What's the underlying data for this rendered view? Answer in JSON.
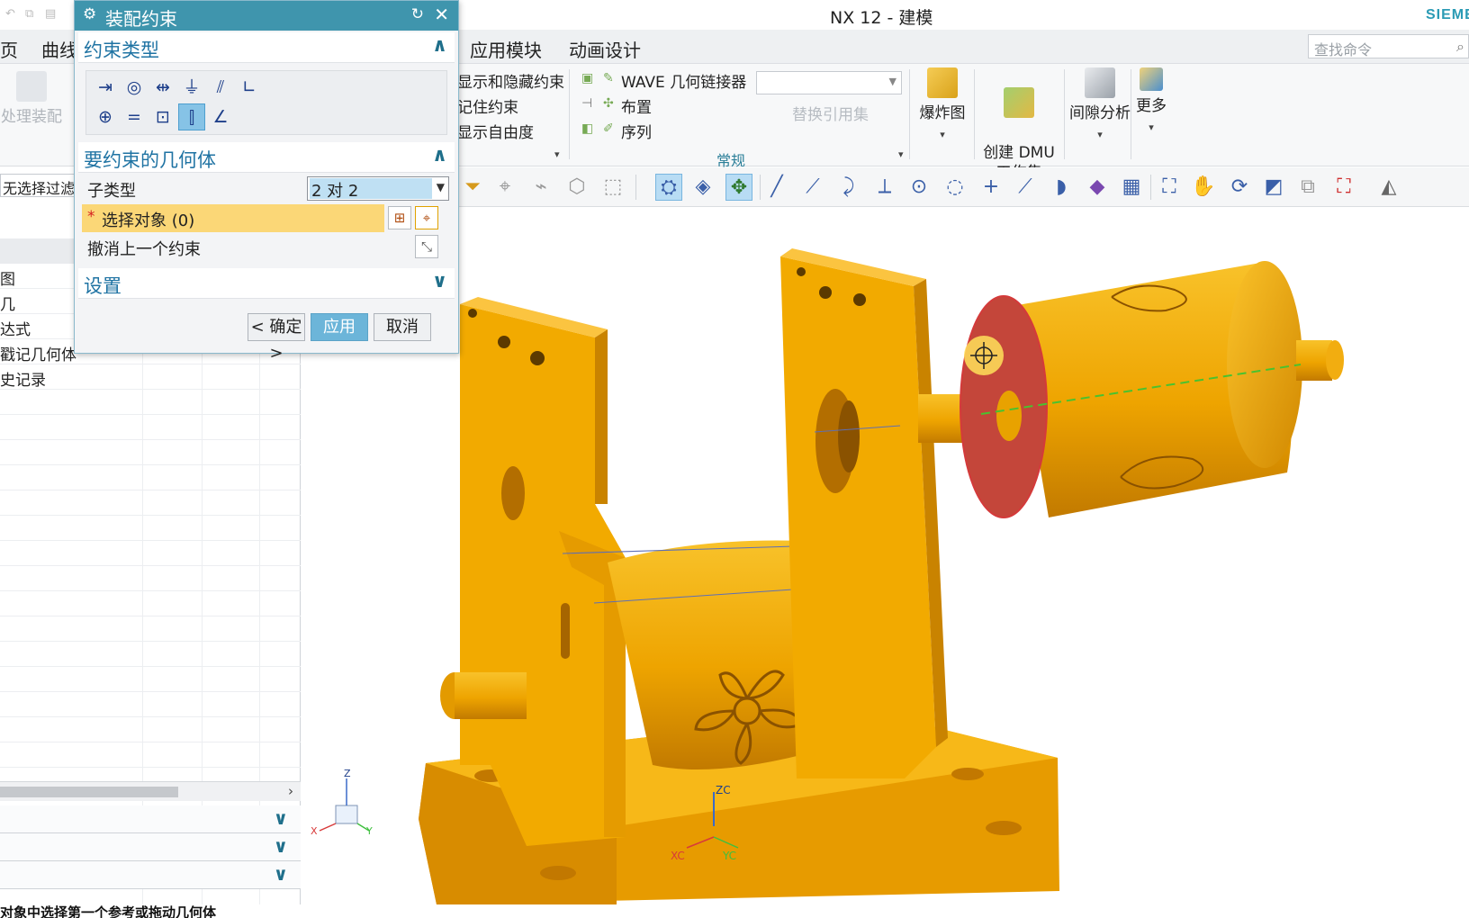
{
  "window": {
    "title": "NX 12 - 建模",
    "brand": "SIEMENS"
  },
  "menubar": {
    "items": [
      "页",
      "曲线",
      "应用模块",
      "动画设计"
    ],
    "search_placeholder": "查找命令"
  },
  "ribbon": {
    "left_button": "处理装配",
    "col1": [
      "显示和隐藏约束",
      "记住约束",
      "显示自由度"
    ],
    "col2": [
      "WAVE 几何链接器",
      "布置",
      "序列"
    ],
    "replace_ref": "替换引用集",
    "group_label": "常规",
    "big_buttons": [
      {
        "label": "爆炸图",
        "icon": "exploded-view-icon"
      },
      {
        "label": "创建 DMU\n工作集",
        "icon": "dmu-workset-icon"
      },
      {
        "label": "间隙分析",
        "icon": "clearance-analysis-icon"
      },
      {
        "label": "更多",
        "icon": "more-icon"
      }
    ]
  },
  "navigator": {
    "filter_value": "无选择过滤器",
    "rows": [
      "图",
      "几",
      "达式",
      "戳记几何体",
      "史记录"
    ]
  },
  "dialog": {
    "title": "装配约束",
    "sections": {
      "constraint_type": "约束类型",
      "geometry": "要约束的几何体",
      "settings": "设置"
    },
    "subtype_label": "子类型",
    "subtype_value": "2 对 2",
    "select_object": "选择对象 (0)",
    "undo_last": "撤消上一个约束",
    "buttons": {
      "ok": "< 确定 >",
      "apply": "应用",
      "cancel": "取消"
    }
  },
  "graphics": {
    "triad_labels": {
      "z": "Z",
      "x": "X",
      "y": "Y"
    },
    "wcs_labels": {
      "zc": "ZC",
      "xc": "XC",
      "yc": "YC"
    },
    "colors": {
      "part": "#f2a900",
      "part_shade": "#c97f00",
      "highlight_face": "#c4463a",
      "accent": "#3f95ad"
    }
  },
  "statusbar": {
    "text": "对象中选择第一个参考或拖动几何体"
  }
}
